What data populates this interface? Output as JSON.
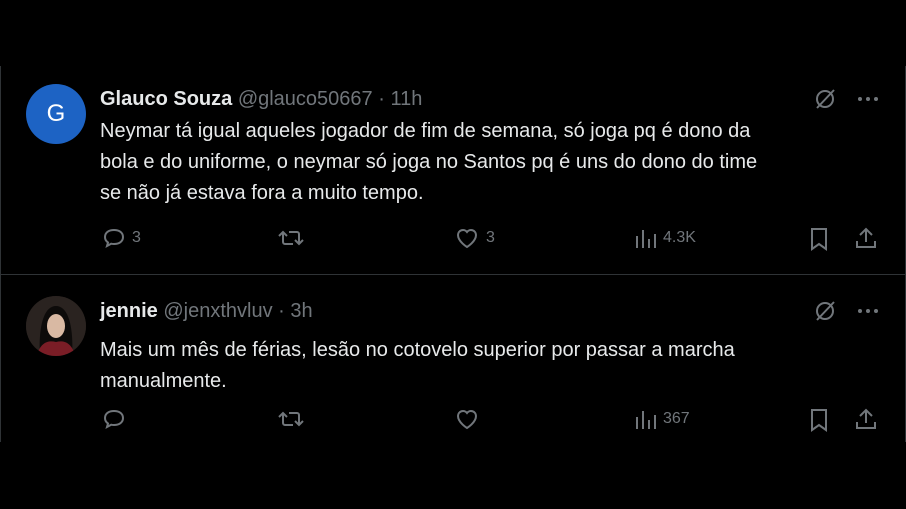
{
  "tweets": [
    {
      "avatar_letter": "G",
      "avatar_color": "#1d63c4",
      "name": "Glauco Souza",
      "handle": "@glauco50667",
      "separator": "·",
      "time": "11h",
      "lines": [
        "Neymar tá igual aqueles jogador de fim de semana,  só joga pq é dono da",
        "bola e do uniforme,  o neymar só joga no Santos pq é uns do dono do time",
        "se não já estava fora a muito tempo."
      ],
      "replies": "3",
      "retweets": "",
      "likes": "3",
      "views": "4.3K"
    },
    {
      "name": "jennie",
      "handle": "@jenxthvluv",
      "separator": "·",
      "time": "3h",
      "lines": [
        "Mais um mês de férias, lesão no cotovelo superior por passar a marcha",
        "manualmente."
      ],
      "replies": "",
      "retweets": "",
      "likes": "",
      "views": "367"
    }
  ],
  "colors": {
    "background": "#000000",
    "text": "#e7e9ea",
    "muted": "#71767b",
    "border": "#2f3336"
  }
}
